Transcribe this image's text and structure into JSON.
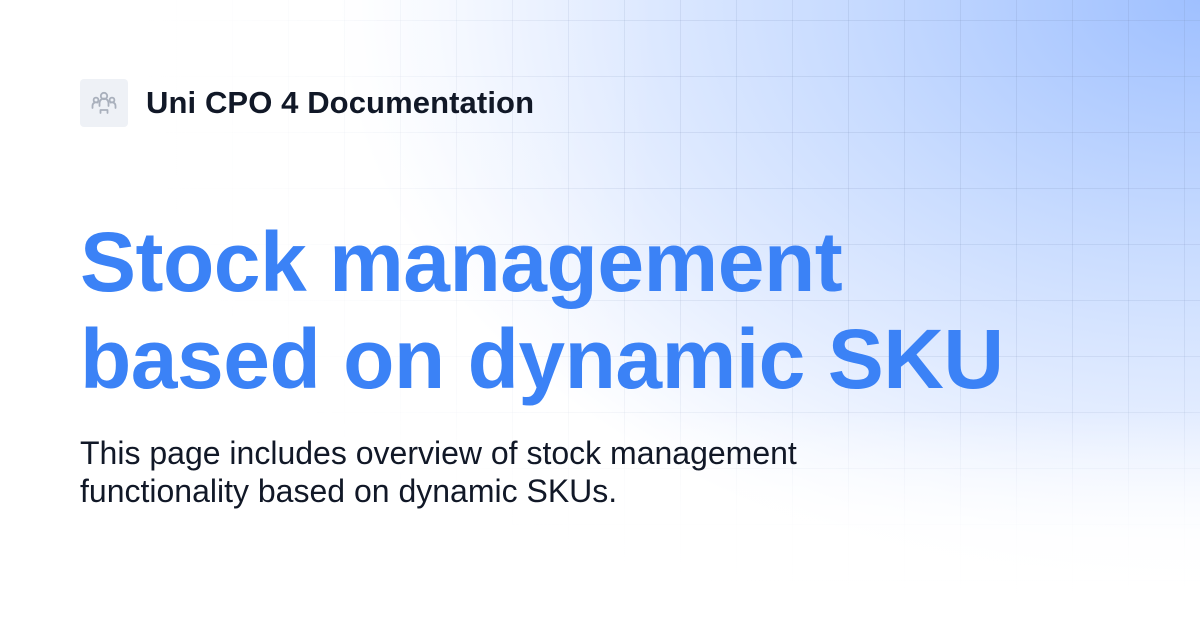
{
  "brand": {
    "logo_icon": "users-group-icon",
    "title": "Uni CPO 4 Documentation"
  },
  "headline": {
    "line1": "Stock management",
    "line2": "based on dynamic SKU"
  },
  "description": "This page includes overview of stock management functionality based on dynamic SKUs.",
  "colors": {
    "accent": "#3b82f6",
    "text": "#111827",
    "gradient_corner": "#9fc0ff"
  }
}
